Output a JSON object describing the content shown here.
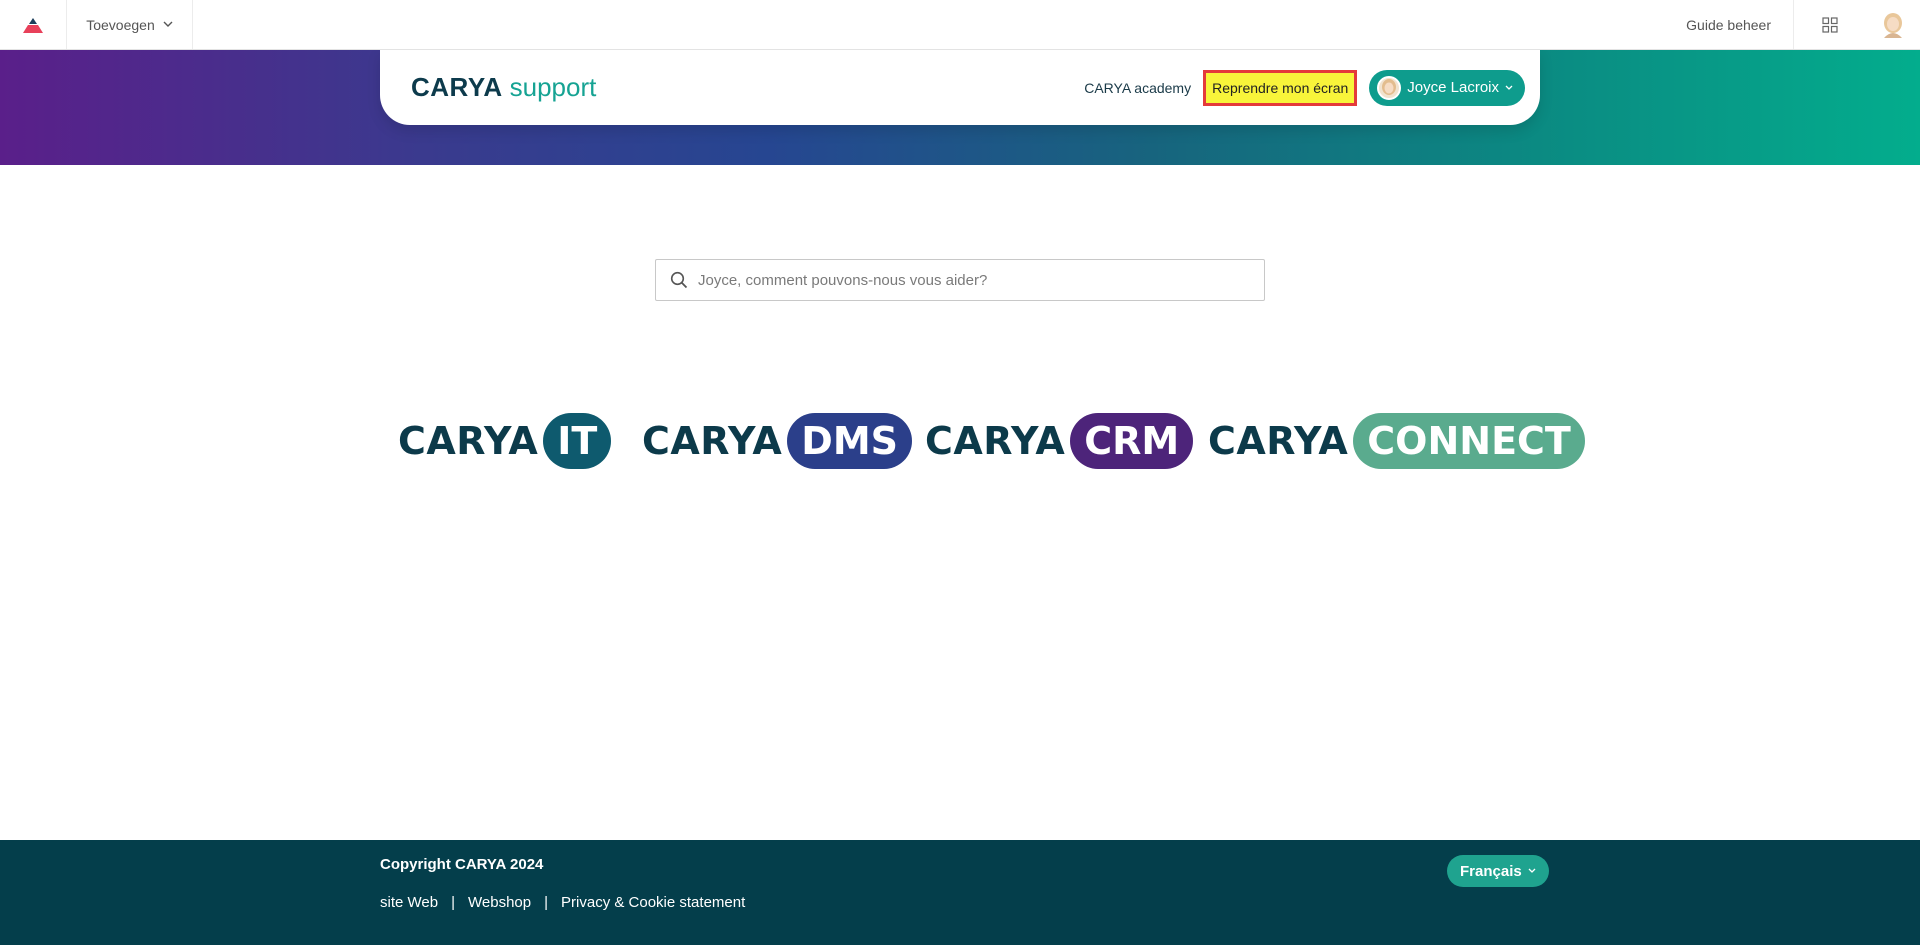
{
  "adminbar": {
    "add_label": "Toevoegen",
    "guide_label": "Guide beheer",
    "icons": {
      "logo": "caret-up-logo-icon",
      "add_chevron": "chevron-down-icon",
      "apps": "grid-icon",
      "avatar": "user-avatar"
    }
  },
  "header": {
    "brand_primary": "CARYA",
    "brand_secondary": "support",
    "academy_link": "CARYA academy",
    "reprendre_button": "Reprendre mon écran",
    "user_name": "Joyce Lacroix"
  },
  "search": {
    "placeholder": "Joyce, comment pouvons-nous vous aider?",
    "value": ""
  },
  "products": [
    {
      "prefix": "CARYA",
      "name": "IT",
      "color": "#0e5a6e"
    },
    {
      "prefix": "CARYA",
      "name": "DMS",
      "color": "#2b3f8a"
    },
    {
      "prefix": "CARYA",
      "name": "CRM",
      "color": "#4d247a"
    },
    {
      "prefix": "CARYA",
      "name": "CONNECT",
      "color": "#5aab8e"
    }
  ],
  "footer": {
    "copyright": "Copyright CARYA 2024",
    "links": [
      "site Web",
      "Webshop",
      "Privacy & Cookie statement"
    ],
    "separator": "|",
    "language": "Français"
  },
  "colors": {
    "hero_gradient": [
      "#5a1f8a",
      "#264691",
      "#03ad8d"
    ],
    "footer_bg": "#043e4b",
    "accent": "#0e9c8d",
    "highlight": "#f8f43a"
  }
}
